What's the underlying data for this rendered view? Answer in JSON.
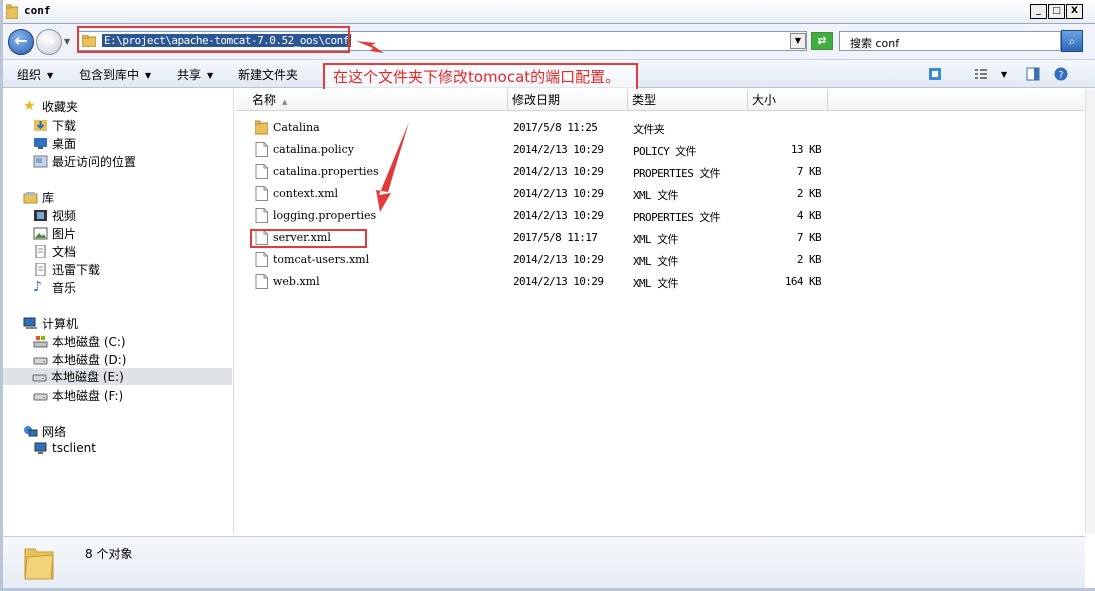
{
  "window": {
    "title": "conf",
    "minimize": "_",
    "maximize": "□",
    "close": "X"
  },
  "address": {
    "path": "E:\\project\\apache-tomcat-7.0.52_oos\\conf",
    "search_placeholder": "搜索 conf"
  },
  "toolbar": {
    "organize": "组织",
    "include_library": "包含到库中",
    "share": "共享",
    "new_folder": "新建文件夹"
  },
  "annotation": {
    "text": "在这个文件夹下修改tomocat的端口配置。"
  },
  "sidebar": {
    "favorites": {
      "label": "收藏夹",
      "items": [
        "下载",
        "桌面",
        "最近访问的位置"
      ]
    },
    "libraries": {
      "label": "库",
      "items": [
        "视频",
        "图片",
        "文档",
        "迅雷下载",
        "音乐"
      ]
    },
    "computer": {
      "label": "计算机",
      "drives": [
        "本地磁盘 (C:)",
        "本地磁盘 (D:)",
        "本地磁盘 (E:)",
        "本地磁盘 (F:)"
      ],
      "selected_index": 2
    },
    "network": {
      "label": "网络",
      "items": [
        "tsclient"
      ]
    }
  },
  "columns": {
    "name": "名称",
    "modified": "修改日期",
    "type": "类型",
    "size": "大小"
  },
  "files": [
    {
      "name": "Catalina",
      "date": "2017/5/8 11:25",
      "type": "文件夹",
      "size": "",
      "kind": "folder"
    },
    {
      "name": "catalina.policy",
      "date": "2014/2/13 10:29",
      "type": "POLICY 文件",
      "size": "13 KB",
      "kind": "file"
    },
    {
      "name": "catalina.properties",
      "date": "2014/2/13 10:29",
      "type": "PROPERTIES 文件",
      "size": "7 KB",
      "kind": "file"
    },
    {
      "name": "context.xml",
      "date": "2014/2/13 10:29",
      "type": "XML 文件",
      "size": "2 KB",
      "kind": "file"
    },
    {
      "name": "logging.properties",
      "date": "2014/2/13 10:29",
      "type": "PROPERTIES 文件",
      "size": "4 KB",
      "kind": "file"
    },
    {
      "name": "server.xml",
      "date": "2017/5/8 11:17",
      "type": "XML 文件",
      "size": "7 KB",
      "kind": "file"
    },
    {
      "name": "tomcat-users.xml",
      "date": "2014/2/13 10:29",
      "type": "XML 文件",
      "size": "2 KB",
      "kind": "file"
    },
    {
      "name": "web.xml",
      "date": "2014/2/13 10:29",
      "type": "XML 文件",
      "size": "164 KB",
      "kind": "file"
    }
  ],
  "status": {
    "count_text": "8 个对象"
  },
  "colors": {
    "annotation_red": "#e23b3b",
    "address_highlight": "#2a5597"
  }
}
